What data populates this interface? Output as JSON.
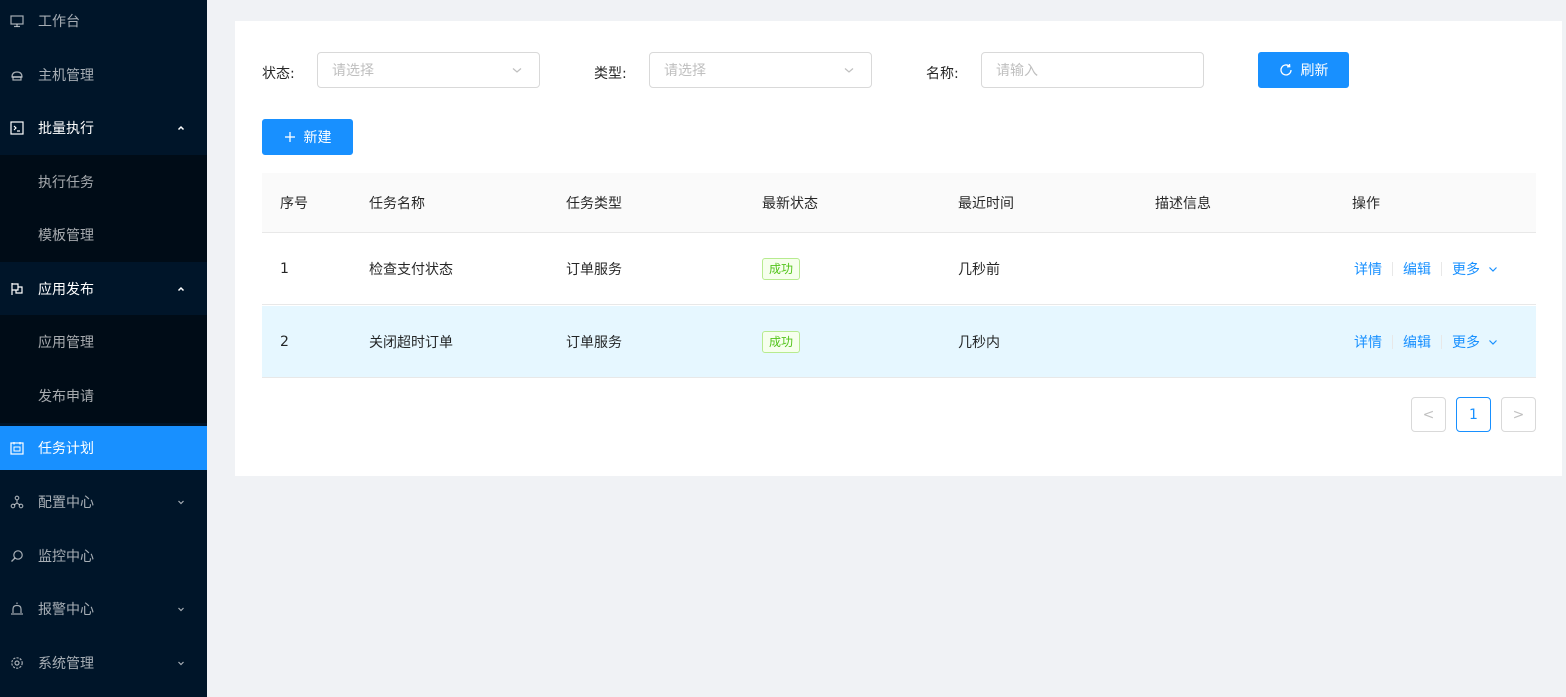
{
  "sidebar": {
    "items": [
      {
        "label": "工作台",
        "icon": "desktop-icon"
      },
      {
        "label": "主机管理",
        "icon": "cloud-server-icon"
      },
      {
        "label": "批量执行",
        "icon": "code-icon",
        "expanded": true
      },
      {
        "label": "执行任务"
      },
      {
        "label": "模板管理"
      },
      {
        "label": "应用发布",
        "icon": "flag-icon",
        "expanded": true
      },
      {
        "label": "应用管理"
      },
      {
        "label": "发布申请"
      },
      {
        "label": "任务计划",
        "icon": "schedule-icon",
        "selected": true
      },
      {
        "label": "配置中心",
        "icon": "deployment-unit-icon"
      },
      {
        "label": "监控中心",
        "icon": "monitor-search-icon"
      },
      {
        "label": "报警中心",
        "icon": "alert-icon"
      },
      {
        "label": "系统管理",
        "icon": "setting-icon"
      }
    ]
  },
  "filters": {
    "status_label": "状态:",
    "status_placeholder": "请选择",
    "type_label": "类型:",
    "type_placeholder": "请选择",
    "name_label": "名称:",
    "name_placeholder": "请输入",
    "refresh_label": "刷新"
  },
  "toolbar": {
    "new_label": "新建"
  },
  "table": {
    "columns": [
      "序号",
      "任务名称",
      "任务类型",
      "最新状态",
      "最近时间",
      "描述信息",
      "操作"
    ],
    "rows": [
      {
        "index": "1",
        "name": "检查支付状态",
        "type": "订单服务",
        "status": "成功",
        "time": "几秒前",
        "desc": ""
      },
      {
        "index": "2",
        "name": "关闭超时订单",
        "type": "订单服务",
        "status": "成功",
        "time": "几秒内",
        "desc": ""
      }
    ],
    "actions": {
      "detail": "详情",
      "edit": "编辑",
      "more": "更多"
    }
  },
  "pagination": {
    "current": "1",
    "prev_symbol": "<",
    "next_symbol": ">"
  },
  "colors": {
    "sidebar_bg": "#001529",
    "submenu_bg": "#000c17",
    "primary": "#1890ff",
    "success": "#52c41a",
    "row_hover": "#e6f7ff"
  }
}
